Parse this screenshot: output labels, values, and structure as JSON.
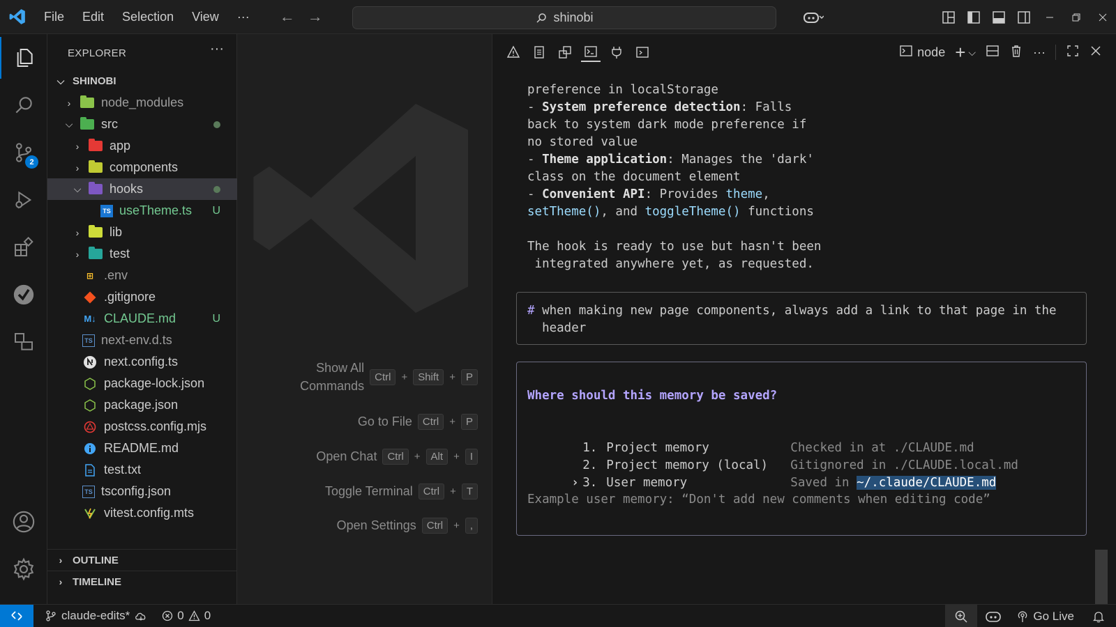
{
  "menu": {
    "file": "File",
    "edit": "Edit",
    "selection": "Selection",
    "view": "View",
    "more": "···"
  },
  "search": {
    "text": "shinobi"
  },
  "explorer": {
    "title": "EXPLORER",
    "root": "SHINOBI",
    "items": [
      {
        "label": "node_modules",
        "type": "folder",
        "color": "#8bc34a"
      },
      {
        "label": "src",
        "type": "folder",
        "color": "#4caf50"
      },
      {
        "label": "app",
        "type": "folder",
        "color": "#e53935"
      },
      {
        "label": "components",
        "type": "folder",
        "color": "#c0ca33"
      },
      {
        "label": "hooks",
        "type": "folder",
        "color": "#7e57c2"
      },
      {
        "label": "useTheme.ts",
        "type": "file",
        "status": "U"
      },
      {
        "label": "lib",
        "type": "folder",
        "color": "#cddc39"
      },
      {
        "label": "test",
        "type": "folder",
        "color": "#26a69a"
      },
      {
        "label": ".env",
        "type": "file"
      },
      {
        "label": ".gitignore",
        "type": "file"
      },
      {
        "label": "CLAUDE.md",
        "type": "file",
        "status": "U"
      },
      {
        "label": "next-env.d.ts",
        "type": "file"
      },
      {
        "label": "next.config.ts",
        "type": "file"
      },
      {
        "label": "package-lock.json",
        "type": "file"
      },
      {
        "label": "package.json",
        "type": "file"
      },
      {
        "label": "postcss.config.mjs",
        "type": "file"
      },
      {
        "label": "README.md",
        "type": "file"
      },
      {
        "label": "test.txt",
        "type": "file"
      },
      {
        "label": "tsconfig.json",
        "type": "file"
      },
      {
        "label": "vitest.config.mts",
        "type": "file"
      }
    ],
    "outline": "OUTLINE",
    "timeline": "TIMELINE",
    "scm_badge": "2",
    "icon_labels": {
      "ts": "TS",
      "md": "M↓"
    }
  },
  "welcome": {
    "shortcuts": [
      {
        "label1": "Show All",
        "label2": "Commands",
        "keys": [
          "Ctrl",
          "Shift",
          "P"
        ]
      },
      {
        "label1": "Go to File",
        "keys": [
          "Ctrl",
          "P"
        ]
      },
      {
        "label1": "Open Chat",
        "keys": [
          "Ctrl",
          "Alt",
          "I"
        ]
      },
      {
        "label1": "Toggle Terminal",
        "keys": [
          "Ctrl",
          "T"
        ]
      },
      {
        "label1": "Open Settings",
        "keys": [
          "Ctrl",
          ","
        ]
      }
    ],
    "plus": "+"
  },
  "panel": {
    "terminal_name": "node"
  },
  "terminal": {
    "l1": "preference in localStorage",
    "l2_dash": "- ",
    "l2_bold": "System preference detection",
    "l2_rest": ": Falls",
    "l3": "back to system dark mode preference if",
    "l4": "no stored value",
    "l5_dash": "- ",
    "l5_bold": "Theme application",
    "l5_rest": ": Manages the 'dark'",
    "l6": "class on the document element",
    "l7_dash": "- ",
    "l7_bold": "Convenient API",
    "l7_rest": ": Provides ",
    "l7_theme": "theme",
    "l7_comma": ",",
    "l8_a": "setTheme()",
    "l8_b": ", and ",
    "l8_c": "toggleTheme()",
    "l8_d": " functions",
    "l9": "The hook is ready to use but hasn't been",
    "l10": " integrated anywhere yet, as requested.",
    "memory_hash": "#",
    "memory_input_1": " when making new page components, always add a link to that page in the",
    "memory_input_2": "  header",
    "question": "Where should this memory be saved?",
    "options": [
      {
        "num": "1.",
        "name": "Project memory",
        "desc": "Checked in at ./CLAUDE.md"
      },
      {
        "num": "2.",
        "name": "Project memory (local)",
        "desc": "Gitignored in ./CLAUDE.local.md"
      },
      {
        "num": "3.",
        "name": "User memory",
        "desc_prefix": "Saved in ",
        "desc_sel": "~/.claude/CLAUDE.md"
      }
    ],
    "example": "Example user memory: “Don't add new comments when editing code”"
  },
  "statusbar": {
    "branch": "claude-edits*",
    "errors": "0",
    "warnings": "0",
    "golive": "Go Live"
  }
}
